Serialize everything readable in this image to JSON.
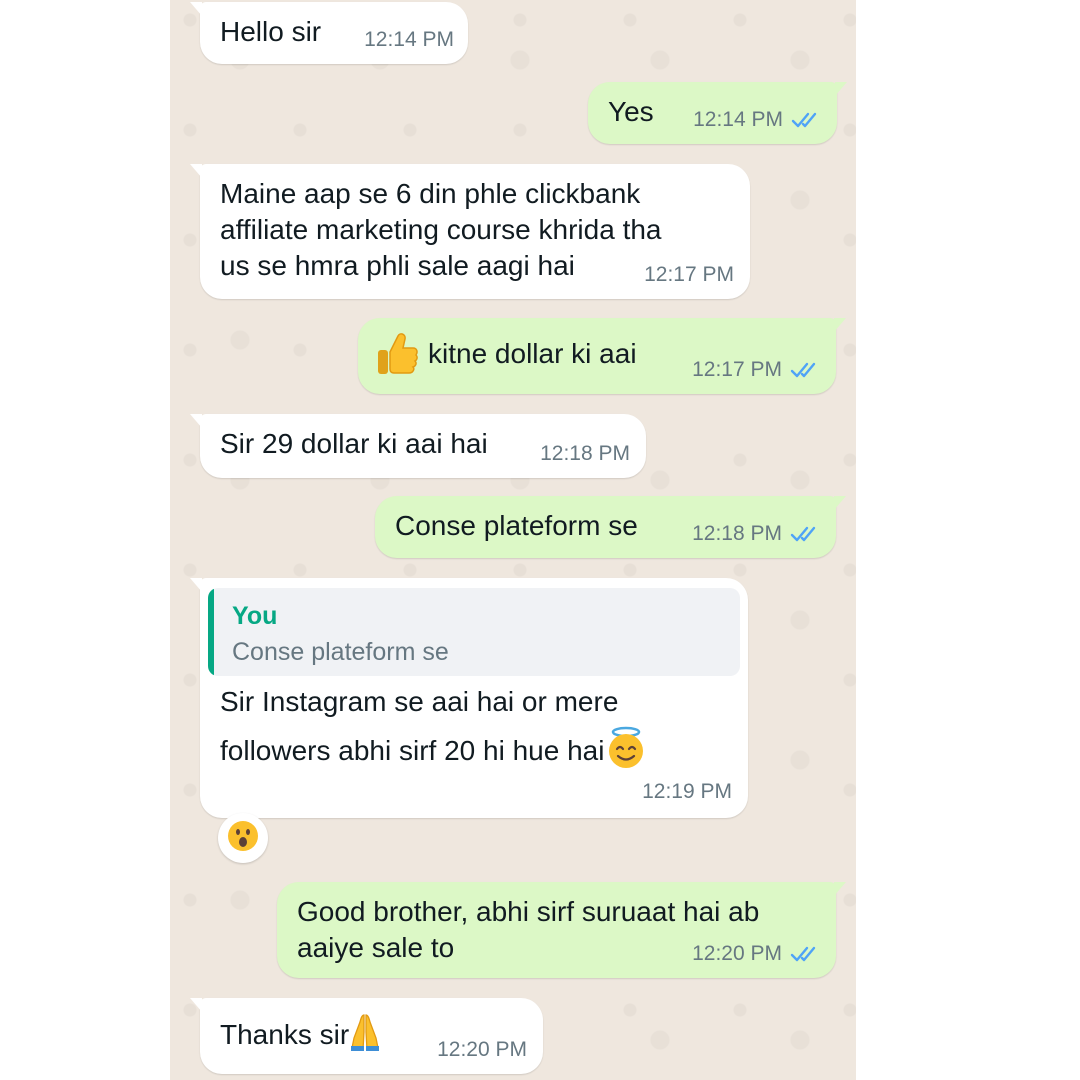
{
  "messages": [
    {
      "text": "Hello sir",
      "time": "12:14 PM"
    },
    {
      "text": "Yes",
      "time": "12:14 PM",
      "status": "read"
    },
    {
      "lines": [
        "Maine aap se 6 din phle clickbank",
        "affiliate marketing course khrida tha",
        "us se hmra phli sale aagi hai"
      ],
      "time": "12:17 PM"
    },
    {
      "text": "kitne dollar ki aai",
      "time": "12:17 PM",
      "status": "read",
      "emoji": "thumbs-up"
    },
    {
      "text": "Sir 29 dollar ki aai hai",
      "time": "12:18 PM"
    },
    {
      "text": "Conse plateform se",
      "time": "12:18 PM",
      "status": "read"
    },
    {
      "quote": {
        "author": "You",
        "text": "Conse plateform se"
      },
      "lines": [
        "Sir Instagram se aai hai or mere",
        "followers abhi sirf 20 hi hue hai"
      ],
      "emoji": "smiling-face-with-halo",
      "time": "12:19 PM",
      "reaction": "hushed-face"
    },
    {
      "lines": [
        "Good brother, abhi sirf suruaat hai ab",
        "aaiye sale to"
      ],
      "time": "12:20 PM",
      "status": "read"
    },
    {
      "text": "Thanks sir",
      "emoji": "folded-hands",
      "time": "12:20 PM"
    }
  ],
  "colors": {
    "chat_bg": "#efe7de",
    "incoming_bubble": "#ffffff",
    "outgoing_bubble": "#dcf8c6",
    "read_ticks": "#4fa3f7",
    "quote_accent": "#06a884",
    "timestamp": "#667781"
  }
}
